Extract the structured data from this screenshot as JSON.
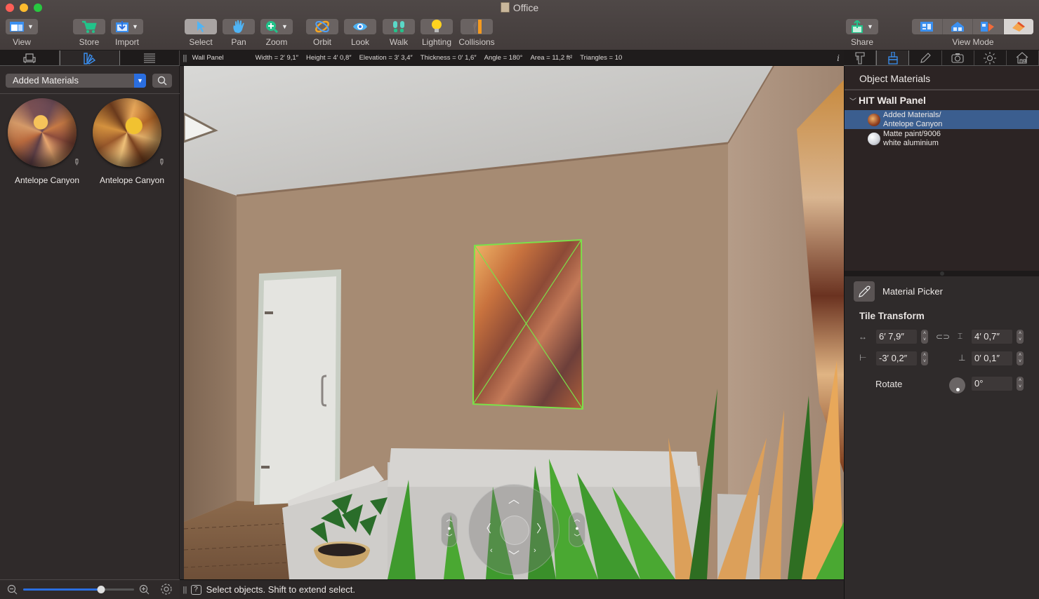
{
  "window": {
    "title": "Office",
    "traffic_lights": [
      "close",
      "minimize",
      "zoom"
    ]
  },
  "toolbar": {
    "items": [
      {
        "id": "view",
        "label": "View",
        "icon": "layout-window-icon",
        "has_menu": true
      },
      {
        "id": "store",
        "label": "Store",
        "icon": "shopping-cart-icon",
        "has_menu": false
      },
      {
        "id": "import",
        "label": "Import",
        "icon": "import-arrow-icon",
        "has_menu": true
      },
      {
        "id": "select",
        "label": "Select",
        "icon": "cursor-arrow-icon",
        "has_menu": false,
        "active": true
      },
      {
        "id": "pan",
        "label": "Pan",
        "icon": "hand-icon",
        "has_menu": false
      },
      {
        "id": "zoom",
        "label": "Zoom",
        "icon": "zoom-plus-icon",
        "has_menu": true
      },
      {
        "id": "orbit",
        "label": "Orbit",
        "icon": "orbit-icon",
        "has_menu": false
      },
      {
        "id": "look",
        "label": "Look",
        "icon": "eye-icon",
        "has_menu": false
      },
      {
        "id": "walk",
        "label": "Walk",
        "icon": "footprints-icon",
        "has_menu": false
      },
      {
        "id": "lighting",
        "label": "Lighting",
        "icon": "lightbulb-icon",
        "has_menu": false
      },
      {
        "id": "collisions",
        "label": "Collisions",
        "icon": "collision-wall-icon",
        "has_menu": false
      },
      {
        "id": "share",
        "label": "Share",
        "icon": "share-icon",
        "has_menu": true
      }
    ],
    "view_mode": {
      "label": "View Mode",
      "options": [
        {
          "id": "plan-2d",
          "icon": "floor-plan-icon"
        },
        {
          "id": "elevation",
          "icon": "house-elevation-icon"
        },
        {
          "id": "split",
          "icon": "split-view-icon"
        },
        {
          "id": "view-3d",
          "icon": "roof-3d-icon",
          "selected": true
        }
      ]
    }
  },
  "left_panel": {
    "tabs": [
      {
        "id": "furniture",
        "icon": "armchair-icon"
      },
      {
        "id": "materials",
        "icon": "swatches-icon",
        "active": true
      },
      {
        "id": "list",
        "icon": "list-icon"
      }
    ],
    "library_select": "Added Materials",
    "materials": [
      {
        "label": "Antelope Canyon"
      },
      {
        "label": "Antelope Canyon"
      }
    ],
    "zoom_slider_value": 0.7
  },
  "info_bar": {
    "object_name": "Wall Panel",
    "fields": [
      "Width = 2′ 9,1″",
      "Height = 4′ 0,8″",
      "Elevation = 3′ 3,4″",
      "Thickness = 0′ 1,6″",
      "Angle = 180°",
      "Area = 11,2 ft²",
      "Triangles = 10"
    ],
    "info_button": "i"
  },
  "status_bar": {
    "text": "Select objects. Shift to extend select."
  },
  "right_panel": {
    "tabs": [
      {
        "id": "dimensions",
        "icon": "caliper-icon"
      },
      {
        "id": "materials",
        "icon": "paintbrush-icon",
        "active": true
      },
      {
        "id": "edit",
        "icon": "pencil-icon"
      },
      {
        "id": "camera",
        "icon": "camera-icon"
      },
      {
        "id": "light",
        "icon": "sun-icon"
      },
      {
        "id": "building",
        "icon": "house-icon"
      }
    ],
    "title": "Object Materials",
    "group": "HIT Wall Panel",
    "materials": [
      {
        "line1": "Added Materials/",
        "line2": "Antelope Canyon",
        "selected": true
      },
      {
        "line1": "Matte paint/9006",
        "line2": "white aluminium",
        "selected": false
      }
    ],
    "material_picker": "Material Picker",
    "tile_transform": {
      "title": "Tile Transform",
      "width": "6′ 7,9″",
      "height": "4′ 0,7″",
      "offset_x": "-3′ 0,2″",
      "offset_y": "0′ 0,1″",
      "rotate_label": "Rotate",
      "rotate": "0°"
    }
  },
  "colors": {
    "accent": "#2a6ee0",
    "selection_row": "#3b5e8f",
    "selection_outline": "#7be04a"
  }
}
